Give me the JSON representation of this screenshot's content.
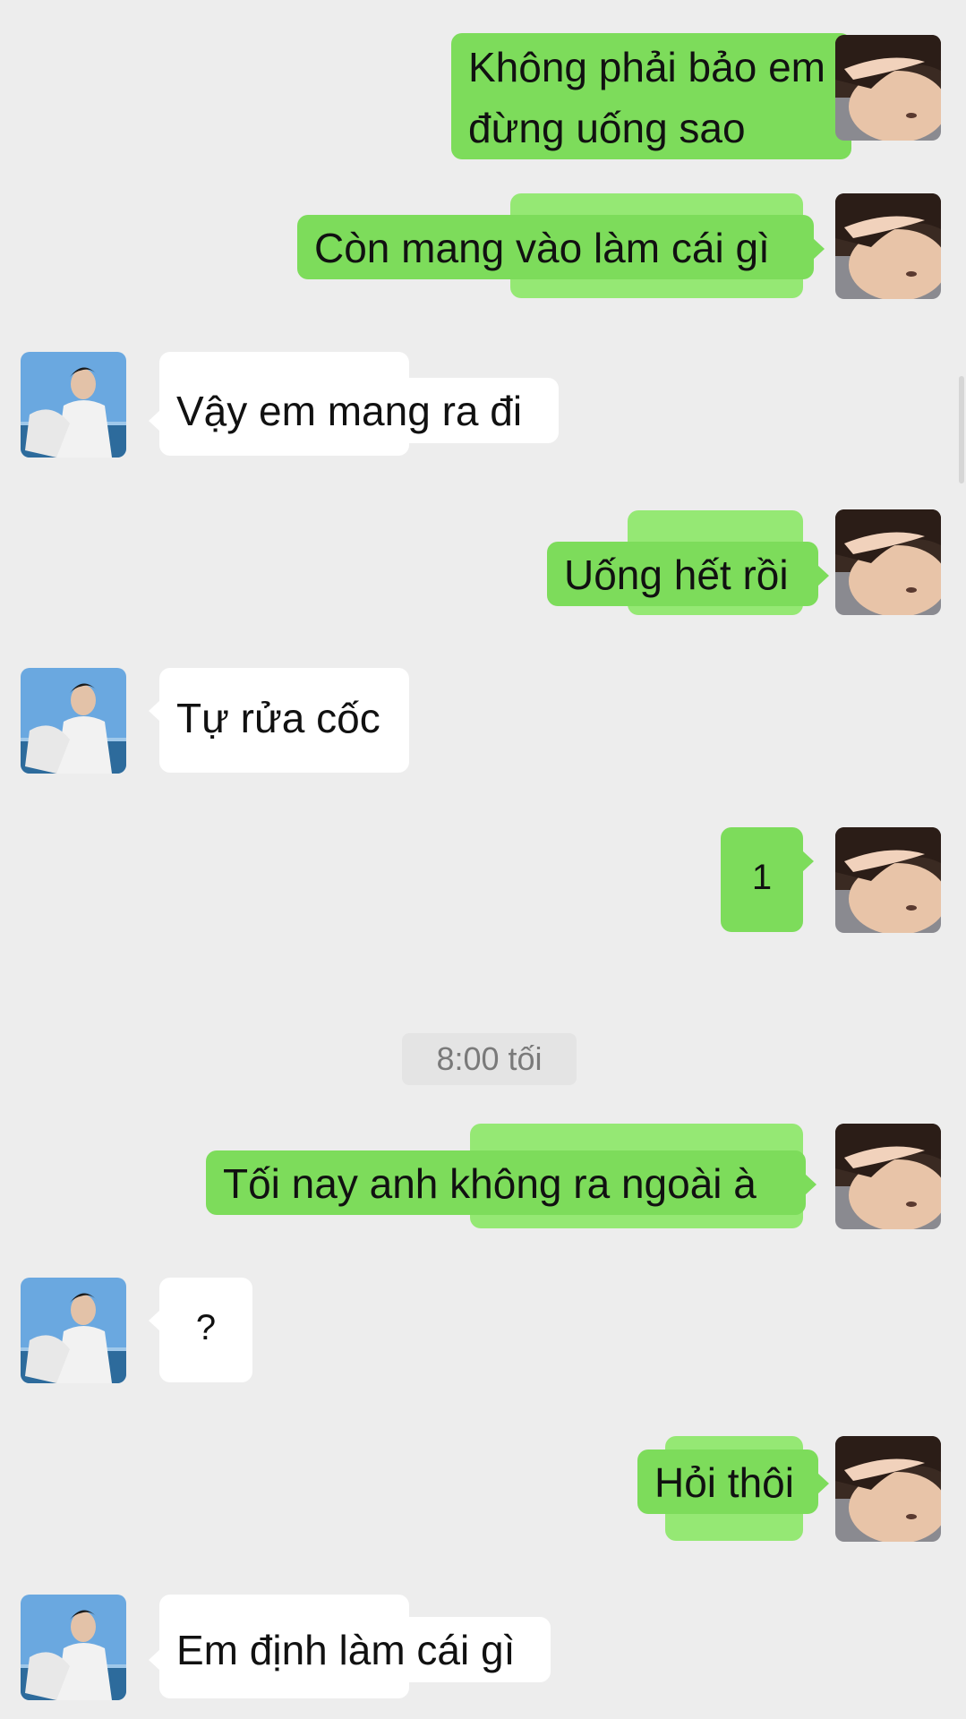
{
  "conversation": {
    "messages": [
      {
        "sender": "me",
        "text": "Không phải bảo em đừng uống sao"
      },
      {
        "sender": "me",
        "text": "Còn mang vào làm cái gì"
      },
      {
        "sender": "other",
        "text": "Vậy em mang ra đi"
      },
      {
        "sender": "me",
        "text": "Uống hết rồi"
      },
      {
        "sender": "other",
        "text": "Tự rửa cốc"
      },
      {
        "sender": "me",
        "text": "1"
      },
      {
        "sender": "me",
        "text": "Tối nay anh không ra ngoài à"
      },
      {
        "sender": "other",
        "text": "?"
      },
      {
        "sender": "me",
        "text": "Hỏi thôi"
      },
      {
        "sender": "other",
        "text": "Em định làm cái gì"
      }
    ],
    "timestamp": "8:00 tối"
  },
  "colors": {
    "background": "#ededed",
    "my_bubble": "#7ddc5b",
    "other_bubble": "#ffffff",
    "timestamp_bg": "#e4e4e4"
  },
  "icons": {
    "my_avatar": "avatar-photo-me",
    "other_avatar": "avatar-photo-other"
  }
}
